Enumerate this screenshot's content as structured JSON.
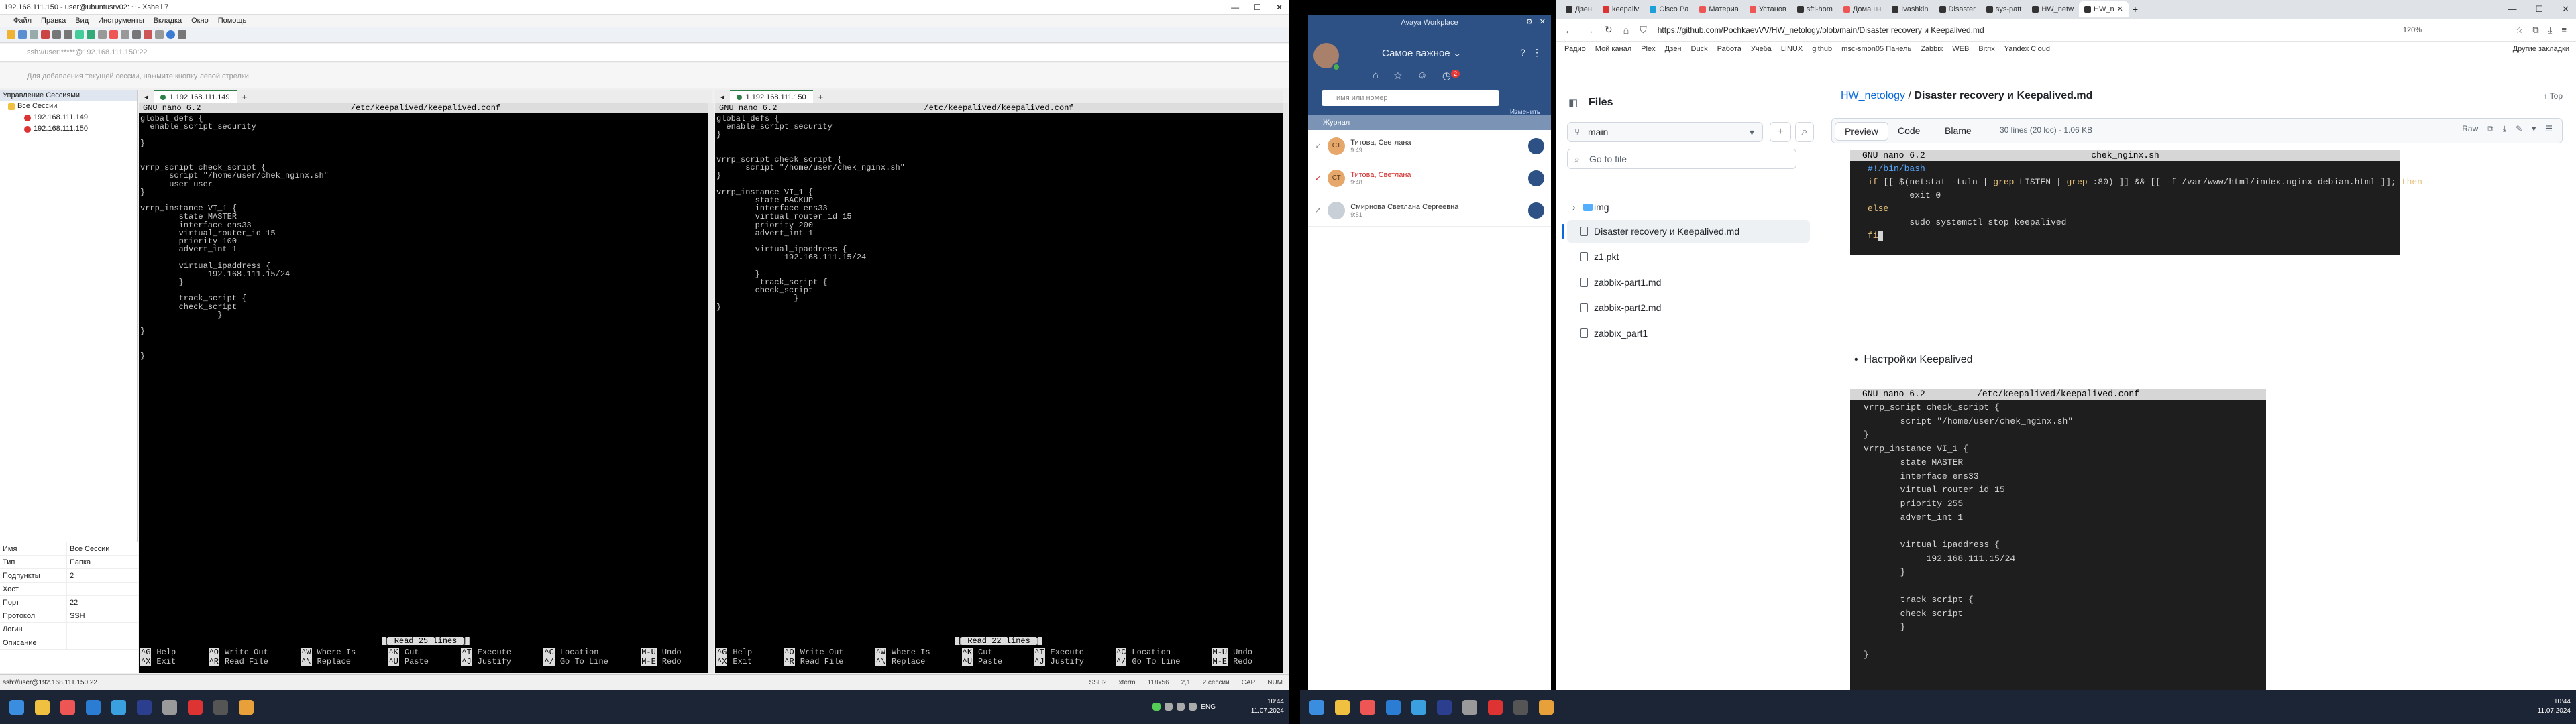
{
  "xshell": {
    "title": "192.168.111.150 - user@ubuntusrv02: ~ - Xshell 7",
    "menu": [
      "Файл",
      "Правка",
      "Вид",
      "Инструменты",
      "Вкладка",
      "Окно",
      "Помощь"
    ],
    "address": "ssh://user:*****@192.168.111.150:22",
    "hint": "Для добавления текущей сессии, нажмите кнопку левой стрелки.",
    "sidebar_title": "Управление Сессиями",
    "tree": [
      {
        "label": "Все Сессии"
      },
      {
        "label": "192.168.111.149"
      },
      {
        "label": "192.168.111.150"
      }
    ],
    "props": [
      {
        "k": "Имя",
        "v": "Все Сессии"
      },
      {
        "k": "Тип",
        "v": "Папка"
      },
      {
        "k": "Подпункты",
        "v": "2"
      },
      {
        "k": "Хост",
        "v": ""
      },
      {
        "k": "Порт",
        "v": "22"
      },
      {
        "k": "Протокол",
        "v": "SSH"
      },
      {
        "k": "Логин",
        "v": ""
      },
      {
        "k": "Описание",
        "v": ""
      }
    ],
    "status_left": "ssh://user@192.168.111.150:22",
    "status_right": [
      "SSH2",
      "xterm",
      "118x56",
      "2,1",
      "2 сессии",
      "CAP",
      "NUM"
    ],
    "pane_left": {
      "tab": "1 192.168.111.149",
      "nano_version": "GNU nano 6.2",
      "file": "/etc/keepalived/keepalived.conf",
      "code": "global_defs {\n  enable_script_security\n\n}\n\n\nvrrp_script check_script {\n      script \"/home/user/chek_nginx.sh\"\n      user user\n}\n\nvrrp_instance VI_1 {\n        state MASTER\n        interface ens33\n        virtual_router_id 15\n        priority 100\n        advert_int 1\n\n        virtual_ipaddress {\n              192.168.111.15/24\n        }\n\n        track_script {\n        check_script\n                }\n\n}\n\n\n}",
      "read_msg": "[ Read 25 lines ]"
    },
    "pane_right": {
      "tab": "1 192.168.111.150",
      "nano_version": "GNU nano 6.2",
      "file": "/etc/keepalived/keepalived.conf",
      "code": "global_defs {\n  enable_script_security\n}\n\n\nvrrp_script check_script {\n      script \"/home/user/chek_nginx.sh\"\n}\n\nvrrp_instance VI_1 {\n        state BACKUP\n        interface ens33\n        virtual_router_id 15\n        priority 200\n        advert_int 1\n\n        virtual_ipaddress {\n              192.168.111.15/24\n\n        }\n         track_script {\n        check_script\n                }\n}",
      "read_msg": "[ Read 22 lines ]"
    },
    "nano_keys": [
      {
        "k": "^G",
        "l": "Help"
      },
      {
        "k": "^X",
        "l": "Exit"
      },
      {
        "k": "^O",
        "l": "Write Out"
      },
      {
        "k": "^R",
        "l": "Read File"
      },
      {
        "k": "^W",
        "l": "Where Is"
      },
      {
        "k": "^\\",
        "l": "Replace"
      },
      {
        "k": "^K",
        "l": "Cut"
      },
      {
        "k": "^U",
        "l": "Paste"
      },
      {
        "k": "^T",
        "l": "Execute"
      },
      {
        "k": "^J",
        "l": "Justify"
      },
      {
        "k": "^C",
        "l": "Location"
      },
      {
        "k": "^/",
        "l": "Go To Line"
      },
      {
        "k": "M-U",
        "l": "Undo"
      },
      {
        "k": "M-E",
        "l": "Redo"
      }
    ]
  },
  "avaya": {
    "title": "Avaya Workplace",
    "filter": "Самое важное",
    "badge": "2",
    "search_placeholder": "имя или номер",
    "change": "Изменить",
    "journal": "Журнал",
    "calls": [
      {
        "initials": "СТ",
        "name": "Титова, Светлана",
        "time": "9:49",
        "missed": false
      },
      {
        "initials": "СТ",
        "name": "Титова, Светлана",
        "time": "9:48",
        "missed": true
      },
      {
        "initials": "",
        "name": "Смирнова Светлана Сергеевна",
        "time": "9:51",
        "missed": false
      }
    ]
  },
  "browser": {
    "tabs": [
      "Дзен",
      "keepaliv",
      "Cisco Pa",
      "Материа",
      "Установ",
      "sftl-hom",
      "Домашн",
      "Ivashkin",
      "Disaster",
      "sys-patt",
      "HW_netw",
      "HW_n"
    ],
    "url": "https://github.com/PochkaevVV/HW_netology/blob/main/Disaster recovery и Keepalived.md",
    "zoom": "120%",
    "bookmarks": [
      "Радио",
      "Мой канал",
      "Plex",
      "Дзен",
      "Duck",
      "Работа",
      "Учеба",
      "LINUX",
      "github",
      "msc-smon05 Панель",
      "Zabbix",
      "WEB",
      "Bitrix",
      "Yandex Cloud"
    ],
    "other_bookmarks": "Другие закладки",
    "files_title": "Files",
    "branch": "main",
    "goto_placeholder": "Go to file",
    "files": [
      "img",
      "Disaster recovery и Keepalived.md",
      "z1.pkt",
      "zabbix-part1.md",
      "zabbix-part2.md",
      "zabbix_part1"
    ],
    "crumb_repo": "HW_netology",
    "crumb_sep": "/",
    "crumb_file": "Disaster recovery и Keepalived.md",
    "top": "Top",
    "tab_preview": "Preview",
    "tab_code": "Code",
    "tab_blame": "Blame",
    "lines": "30 lines (20 loc) · 1.06 KB",
    "raw": "Raw",
    "term1_version": "GNU nano 6.2",
    "term1_file": "chek_nginx.sh",
    "bullet": "Настройки Keepalived",
    "term2_version": "GNU nano 6.2",
    "term2_file": "/etc/keepalived/keepalived.conf",
    "term2_code": "vrrp_script check_script {\n       script \"/home/user/chek_nginx.sh\"\n}\nvrrp_instance VI_1 {\n       state MASTER\n       interface ens33\n       virtual_router_id 15\n       priority 255\n       advert_int 1\n\n       virtual_ipaddress {\n            192.168.111.15/24\n       }\n\n       track_script {\n       check_script\n       }\n\n}"
  },
  "taskbar": {
    "lang": "ENG",
    "time": "10:44",
    "date": "11.07.2024"
  }
}
